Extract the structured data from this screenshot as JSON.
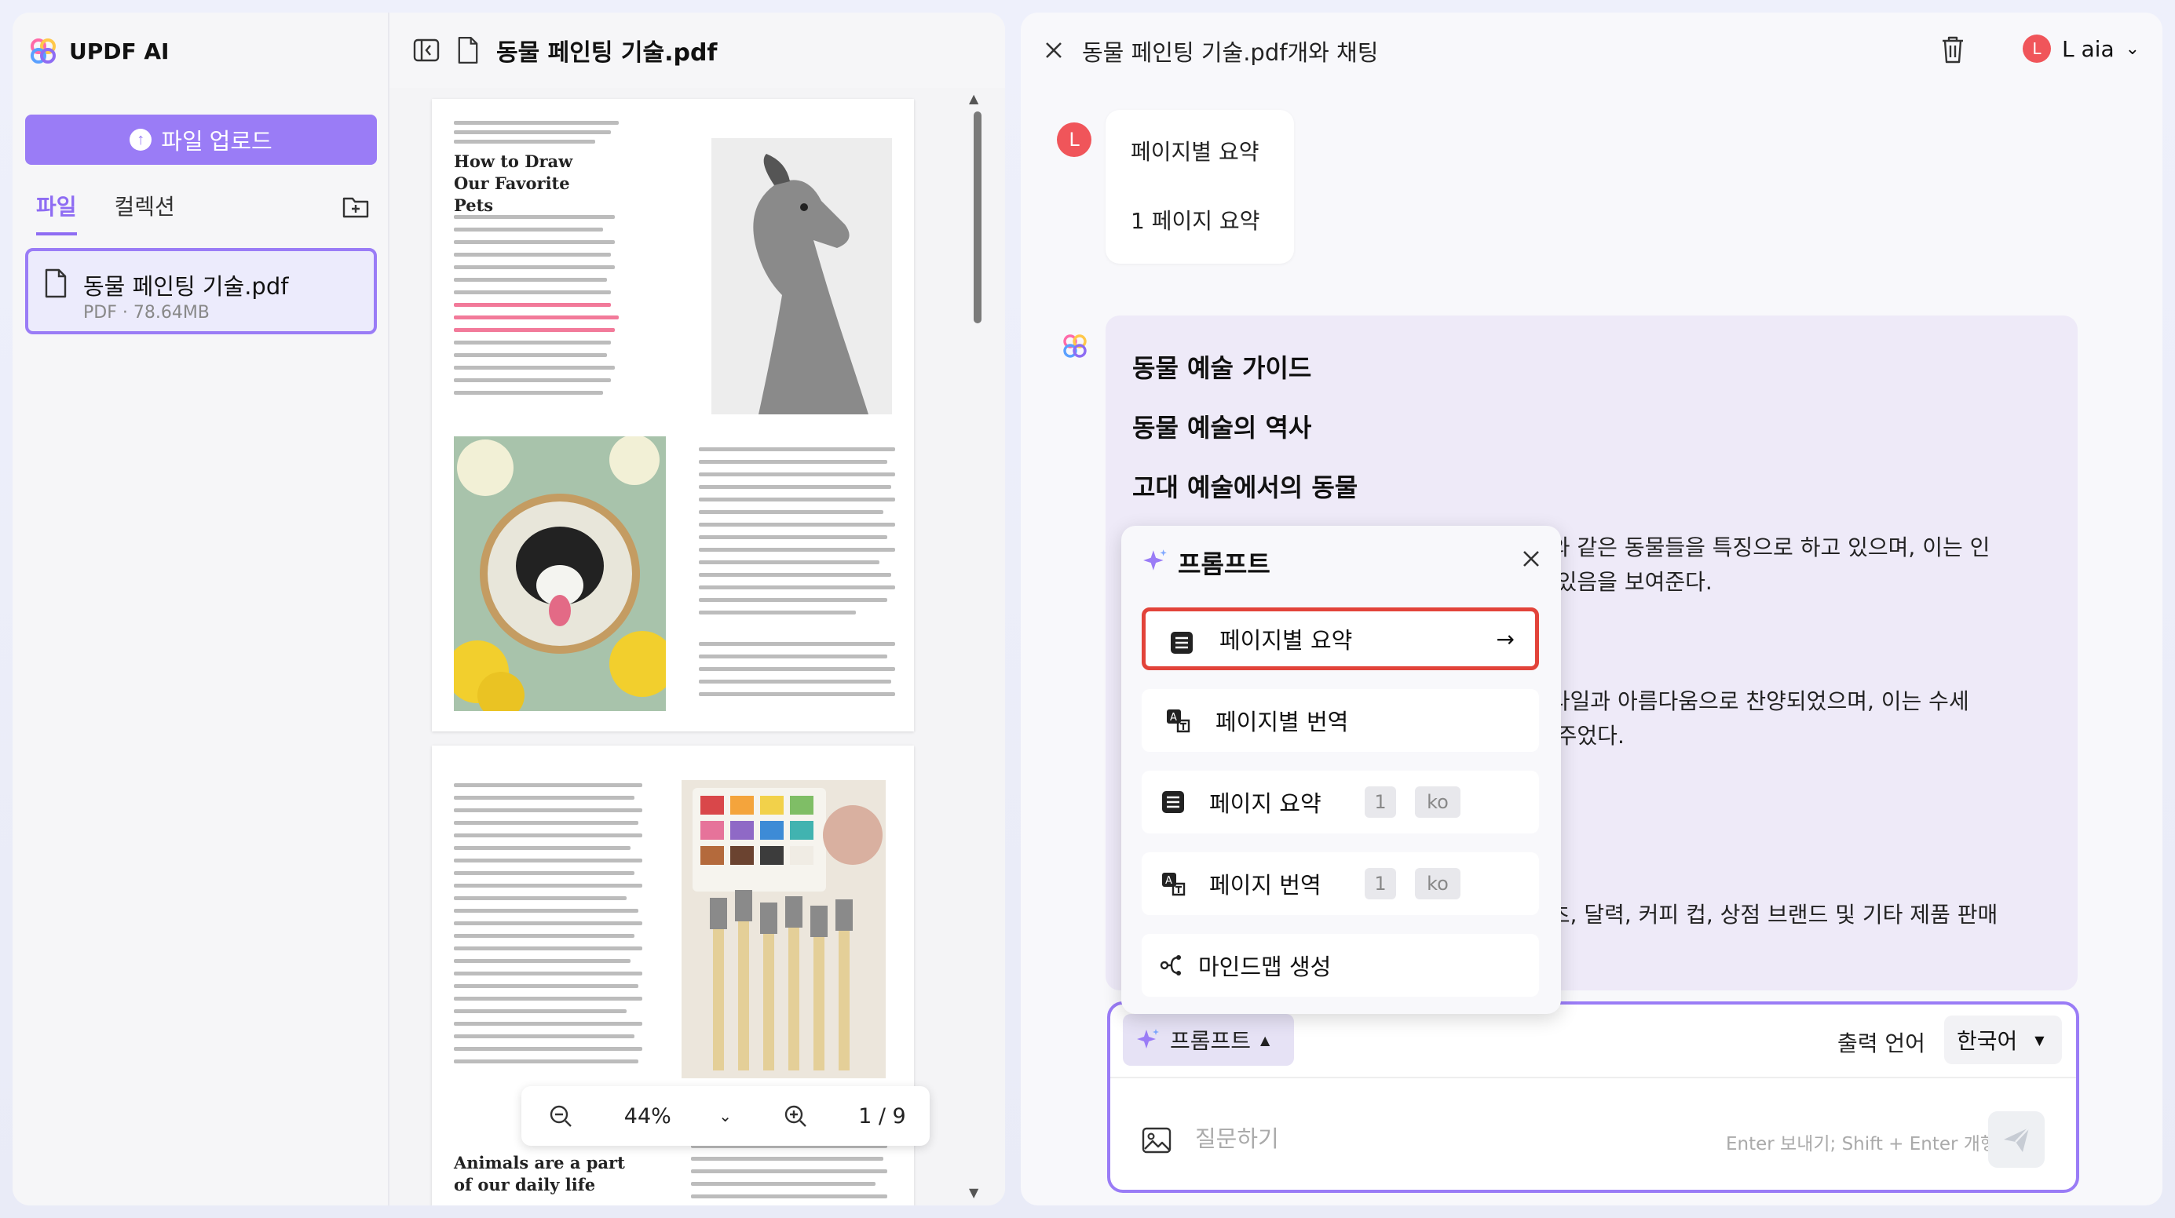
{
  "app": {
    "name": "UPDF AI"
  },
  "sidebar": {
    "upload_label": "파일 업로드",
    "tabs": [
      {
        "label": "파일"
      },
      {
        "label": "컬렉션"
      }
    ],
    "file": {
      "name": "동물 페인팅 기술.pdf",
      "meta": "PDF · 78.64MB"
    }
  },
  "viewer": {
    "filename": "동물 페인팅 기술.pdf",
    "page1_heading": "How to Draw Our Favorite Pets",
    "page2_heading": "Animals are a part of our daily life",
    "zoom": "44%",
    "page_indicator": "1 / 9"
  },
  "chat": {
    "title": "동물 페인팅 기술.pdf개와 채팅",
    "user_name": "L aia",
    "user_initial": "L",
    "user_message": [
      "페이지별 요약",
      "1 페이지 요약"
    ],
    "ai_headings": [
      "동물 예술 가이드",
      "동물 예술의 역사",
      "고대 예술에서의 동물"
    ],
    "ai_text": [
      "니와 같은 동물들을 특징으로 하고 있으며, 이는 인",
      "고 있음을 보여준다.",
      "스타일과 아름다움으로 찬양되었으며, 이는 수세",
      "을 주었다.",
      "셔츠, 달력, 커피 컵, 상점 브랜드 및 기타 제품 판매"
    ]
  },
  "prompt_menu": {
    "title": "프롬프트",
    "options": [
      {
        "label": "페이지별 요약",
        "icon": "list-icon"
      },
      {
        "label": "페이지별 번역",
        "icon": "translate-icon"
      },
      {
        "label": "페이지 요약",
        "icon": "list-icon",
        "page": "1",
        "lang": "ko"
      },
      {
        "label": "페이지 번역",
        "icon": "translate-icon",
        "page": "1",
        "lang": "ko"
      },
      {
        "label": "마인드맵 생성",
        "icon": "mindmap-icon"
      }
    ]
  },
  "composer": {
    "prompt_label": "프롬프트",
    "output_lang_label": "출력 언어",
    "output_lang_value": "한국어",
    "input_placeholder": "질문하기",
    "hint": "Enter 보내기; Shift + Enter 개행"
  },
  "colors": {
    "accent": "#9a7cf6",
    "highlight": "#e2433a",
    "avatar": "#f0555a"
  }
}
